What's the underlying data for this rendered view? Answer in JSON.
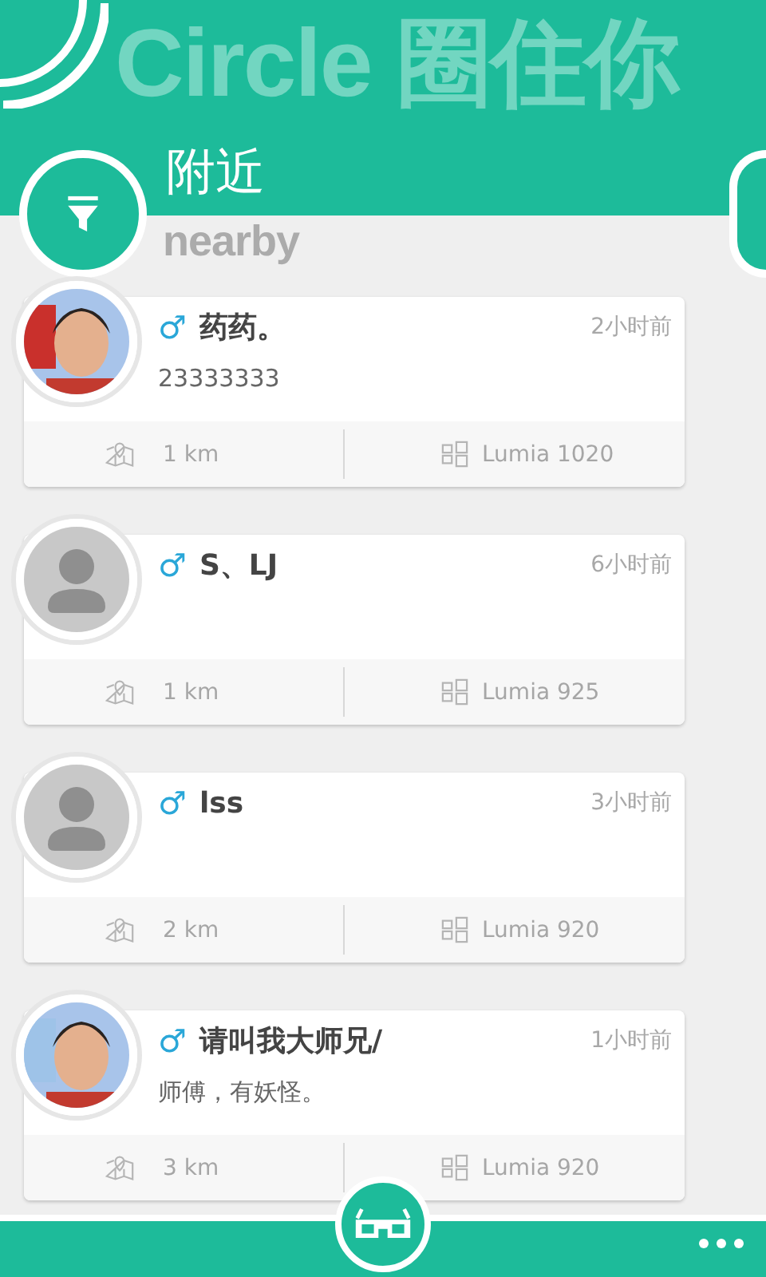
{
  "app_title": "Circle 圈住你",
  "page": {
    "title": "附近",
    "subtitle": "nearby"
  },
  "people": [
    {
      "name": "药药。",
      "gender": "♂",
      "time": "2小时前",
      "message": "23333333",
      "distance": "1 km",
      "device": "Lumia 1020"
    },
    {
      "name": "S、LJ",
      "gender": "♂",
      "time": "6小时前",
      "avatar": {
        "kind": "default"
      },
      "distance": "1 km",
      "device": "Lumia 925"
    },
    {
      "name": "lss",
      "gender": "♂",
      "time": "3小时前",
      "avatar": {
        "kind": "default"
      },
      "distance": "2 km",
      "device": "Lumia 920"
    },
    {
      "name": "请叫我大师兄/",
      "gender": "♂",
      "time": "1小时前",
      "message": "师傅，有妖怪。",
      "distance": "3 km",
      "device": "Lumia 920"
    }
  ]
}
